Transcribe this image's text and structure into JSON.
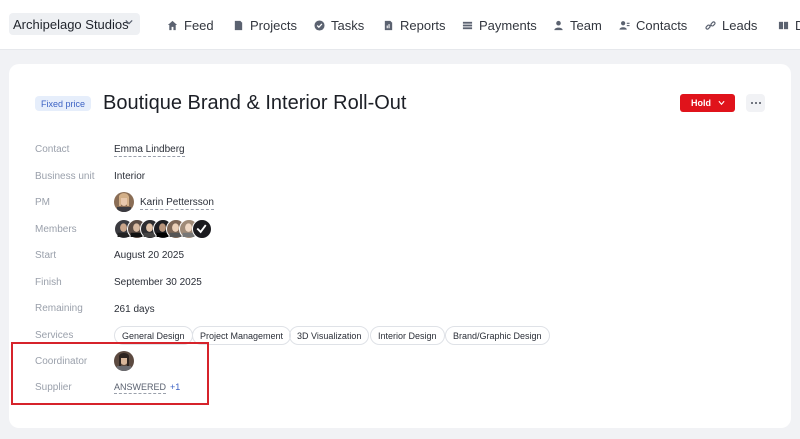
{
  "header": {
    "workspace": "Archipelago Studios",
    "nav": [
      {
        "label": "Feed",
        "icon": "home-icon"
      },
      {
        "label": "Projects",
        "icon": "document-icon"
      },
      {
        "label": "Tasks",
        "icon": "check-circle-icon"
      },
      {
        "label": "Reports",
        "icon": "report-icon"
      },
      {
        "label": "Payments",
        "icon": "payments-icon"
      },
      {
        "label": "Team",
        "icon": "person-icon"
      },
      {
        "label": "Contacts",
        "icon": "contacts-icon"
      },
      {
        "label": "Leads",
        "icon": "link-icon"
      },
      {
        "label": "D",
        "icon": "board-icon"
      }
    ]
  },
  "project": {
    "badge": "Fixed price",
    "title": "Boutique Brand & Interior Roll-Out",
    "status": "Hold",
    "fields": {
      "contact": {
        "label": "Contact",
        "value": "Emma Lindberg"
      },
      "business_unit": {
        "label": "Business unit",
        "value": "Interior"
      },
      "pm": {
        "label": "PM",
        "value": "Karin Pettersson"
      },
      "members": {
        "label": "Members"
      },
      "start": {
        "label": "Start",
        "value": "August 20 2025"
      },
      "finish": {
        "label": "Finish",
        "value": "September 30 2025"
      },
      "remaining": {
        "label": "Remaining",
        "value": "261 days"
      },
      "services": {
        "label": "Services",
        "items": [
          "General Design",
          "Project Management",
          "3D Visualization",
          "Interior Design",
          "Brand/Graphic Design"
        ]
      },
      "coordinator": {
        "label": "Coordinator"
      },
      "supplier": {
        "label": "Supplier",
        "value": "ANSWERED",
        "extra": "+1"
      }
    }
  },
  "colors": {
    "accent": "#3d63c4",
    "hold": "#e0131b",
    "highlight": "#d6232b"
  }
}
